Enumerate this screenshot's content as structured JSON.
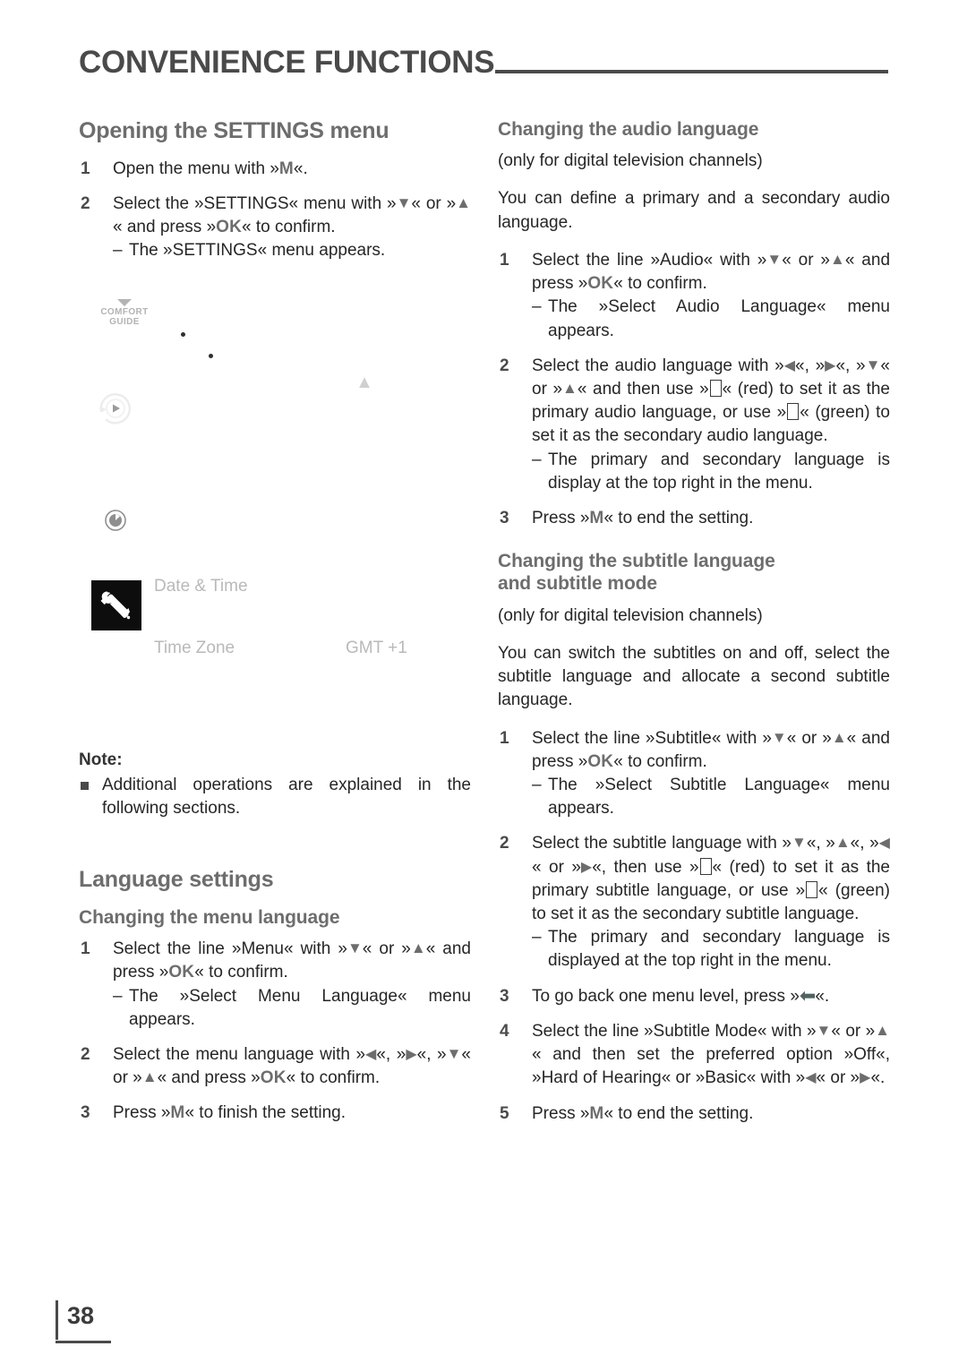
{
  "header": {
    "title": "CONVENIENCE FUNCTIONS"
  },
  "left_column": {
    "section_title": "Opening the SETTINGS menu",
    "steps": [
      {
        "num": "1",
        "text_before": "Open the menu with »",
        "key": "M",
        "text_after": "«."
      },
      {
        "num": "2",
        "line1_a": "Select the »SETTINGS« menu with »",
        "line1_b": "« or »",
        "line1_c": "« and press »",
        "ok": "OK",
        "line1_d": "« to confirm.",
        "dash": "The »SETTINGS« menu appears."
      }
    ],
    "screenshot": {
      "comfort_guide_line1": "COMFORT",
      "comfort_guide_line2": "GUIDE",
      "label_date_time": "Date & Time",
      "label_time_zone": "Time Zone",
      "value_time_zone": "GMT +1"
    },
    "note": {
      "title": "Note:",
      "items": [
        "Additional operations are explained in the following sections."
      ]
    },
    "language_settings_title": "Language settings",
    "menu_language_title": "Changing the menu language",
    "menu_language_steps": [
      {
        "num": "1",
        "a": "Select the line »Menu« with »",
        "b": "« or »",
        "c": "« and press »",
        "ok": "OK",
        "d": "« to confirm.",
        "dash": "The »Select Menu Language« menu appears."
      },
      {
        "num": "2",
        "a": "Select the menu language with »",
        "b": "«, »",
        "c": "«, »",
        "d": "« or »",
        "e": "« and press »",
        "ok": "OK",
        "f": "« to confirm."
      },
      {
        "num": "3",
        "a": "Press »",
        "key": "M",
        "b": "« to finish the setting."
      }
    ]
  },
  "right_column": {
    "audio_title": "Changing the audio language",
    "audio_note": "(only for digital television channels)",
    "audio_intro": "You can define a primary and a secondary audio language.",
    "audio_steps": [
      {
        "num": "1",
        "a": "Select the line »Audio« with »",
        "b": "« or »",
        "c": "« and press »",
        "ok": "OK",
        "d": "« to confirm.",
        "dash": "The »Select Audio Language« menu appears."
      },
      {
        "num": "2",
        "a": "Select the audio language with »",
        "b": "«, »",
        "c": "«, »",
        "d": "« or »",
        "e": "« and then use »",
        "f": "« (red) to set it as the primary audio language, or use »",
        "g": "« (green) to set it as the secondary audio language.",
        "dash": "The primary and secondary language is display at the top right in the menu."
      },
      {
        "num": "3",
        "a": "Press »",
        "key": "M",
        "b": "« to end the setting."
      }
    ],
    "subtitle_title_line1": "Changing the subtitle language",
    "subtitle_title_line2": "and subtitle mode",
    "subtitle_note": "(only for digital television channels)",
    "subtitle_intro": "You can switch the subtitles on and off, select the subtitle language and allocate a second subtitle language.",
    "subtitle_steps": [
      {
        "num": "1",
        "a": "Select the line »Subtitle« with »",
        "b": "« or »",
        "c": "« and press »",
        "ok": "OK",
        "d": "« to confirm.",
        "dash": "The »Select Subtitle Language« menu appears."
      },
      {
        "num": "2",
        "a": "Select the subtitle language with »",
        "b": "«, »",
        "c": "«, »",
        "d": "« or »",
        "e": "«, then use »",
        "f": "« (red) to set it as the primary subtitle language, or use »",
        "g": "« (green) to set it as the secondary subtitle language.",
        "dash": "The primary and secondary language is displayed at the top right in the menu."
      },
      {
        "num": "3",
        "a": "To go back one menu level, press »",
        "b": "«."
      },
      {
        "num": "4",
        "a": "Select the line »Subtitle Mode« with »",
        "b": "« or »",
        "c": "« and then set the preferred option »Off«, »Hard of Hearing« or »Basic« with »",
        "d": "« or »",
        "e": "«."
      },
      {
        "num": "5",
        "a": "Press »",
        "key": "M",
        "b": "« to end the setting."
      }
    ]
  },
  "footer": {
    "page_number": "38"
  },
  "glyphs": {
    "down": "▼",
    "up": "▲",
    "left": "◀",
    "right": "▶",
    "back": "⬅"
  },
  "colors": {
    "heading": "#6d6d6d",
    "body": "#262626",
    "rule": "#4a4a4a"
  }
}
